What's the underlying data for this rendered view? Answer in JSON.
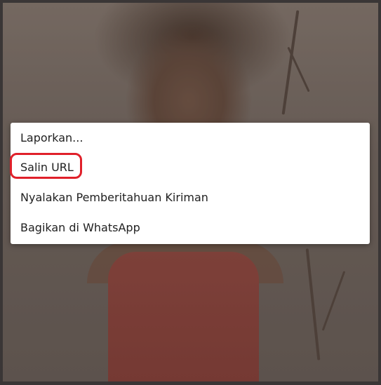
{
  "menu": {
    "items": [
      {
        "label": "Laporkan..."
      },
      {
        "label": "Salin URL"
      },
      {
        "label": "Nyalakan Pemberitahuan Kiriman"
      },
      {
        "label": "Bagikan di WhatsApp"
      }
    ]
  },
  "annotation": {
    "color": "#e0202a",
    "target": "Salin URL"
  }
}
